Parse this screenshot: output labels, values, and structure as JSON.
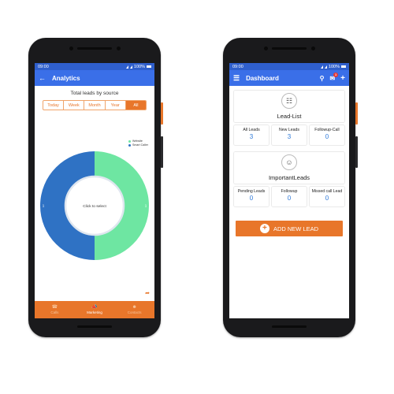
{
  "status_bar": {
    "time": "09:00",
    "battery": "100%"
  },
  "analytics": {
    "title": "Analytics",
    "chart_title": "Total leads by source",
    "tabs": [
      "Today",
      "Week",
      "Month",
      "Year",
      "All"
    ],
    "active_tab": "All",
    "legend": [
      {
        "label": "Website",
        "color": "#6ee6a2"
      },
      {
        "label": "Smart Caller",
        "color": "#2f72c4"
      }
    ],
    "center_label": "Click to select",
    "slice_labels": [
      "1",
      "1"
    ],
    "bottom_nav": [
      {
        "label": "Calls",
        "icon": "calls-icon",
        "active": false
      },
      {
        "label": "Marketing",
        "icon": "megaphone-icon",
        "active": true
      },
      {
        "label": "Contacts",
        "icon": "contacts-icon",
        "active": false
      }
    ],
    "chart_data": {
      "type": "pie",
      "categories": [
        "Website",
        "Smart Caller"
      ],
      "values": [
        1,
        1
      ],
      "colors": [
        "#6ee6a2",
        "#2f72c4"
      ],
      "title": "Total leads by source"
    }
  },
  "dashboard": {
    "title": "Dashboard",
    "notification_count": "1",
    "lead_list": {
      "title": "Lead-List",
      "stats": [
        {
          "label": "All Leads",
          "value": "3"
        },
        {
          "label": "New Leads",
          "value": "3"
        },
        {
          "label": "Followup-Call",
          "value": "0"
        }
      ]
    },
    "important_leads": {
      "title": "ImportantLeads",
      "stats": [
        {
          "label": "Pending Leads",
          "value": "0"
        },
        {
          "label": "Followup",
          "value": "0"
        },
        {
          "label": "Missed call Lead",
          "value": "0"
        }
      ]
    },
    "add_button": "ADD NEW LEAD"
  }
}
